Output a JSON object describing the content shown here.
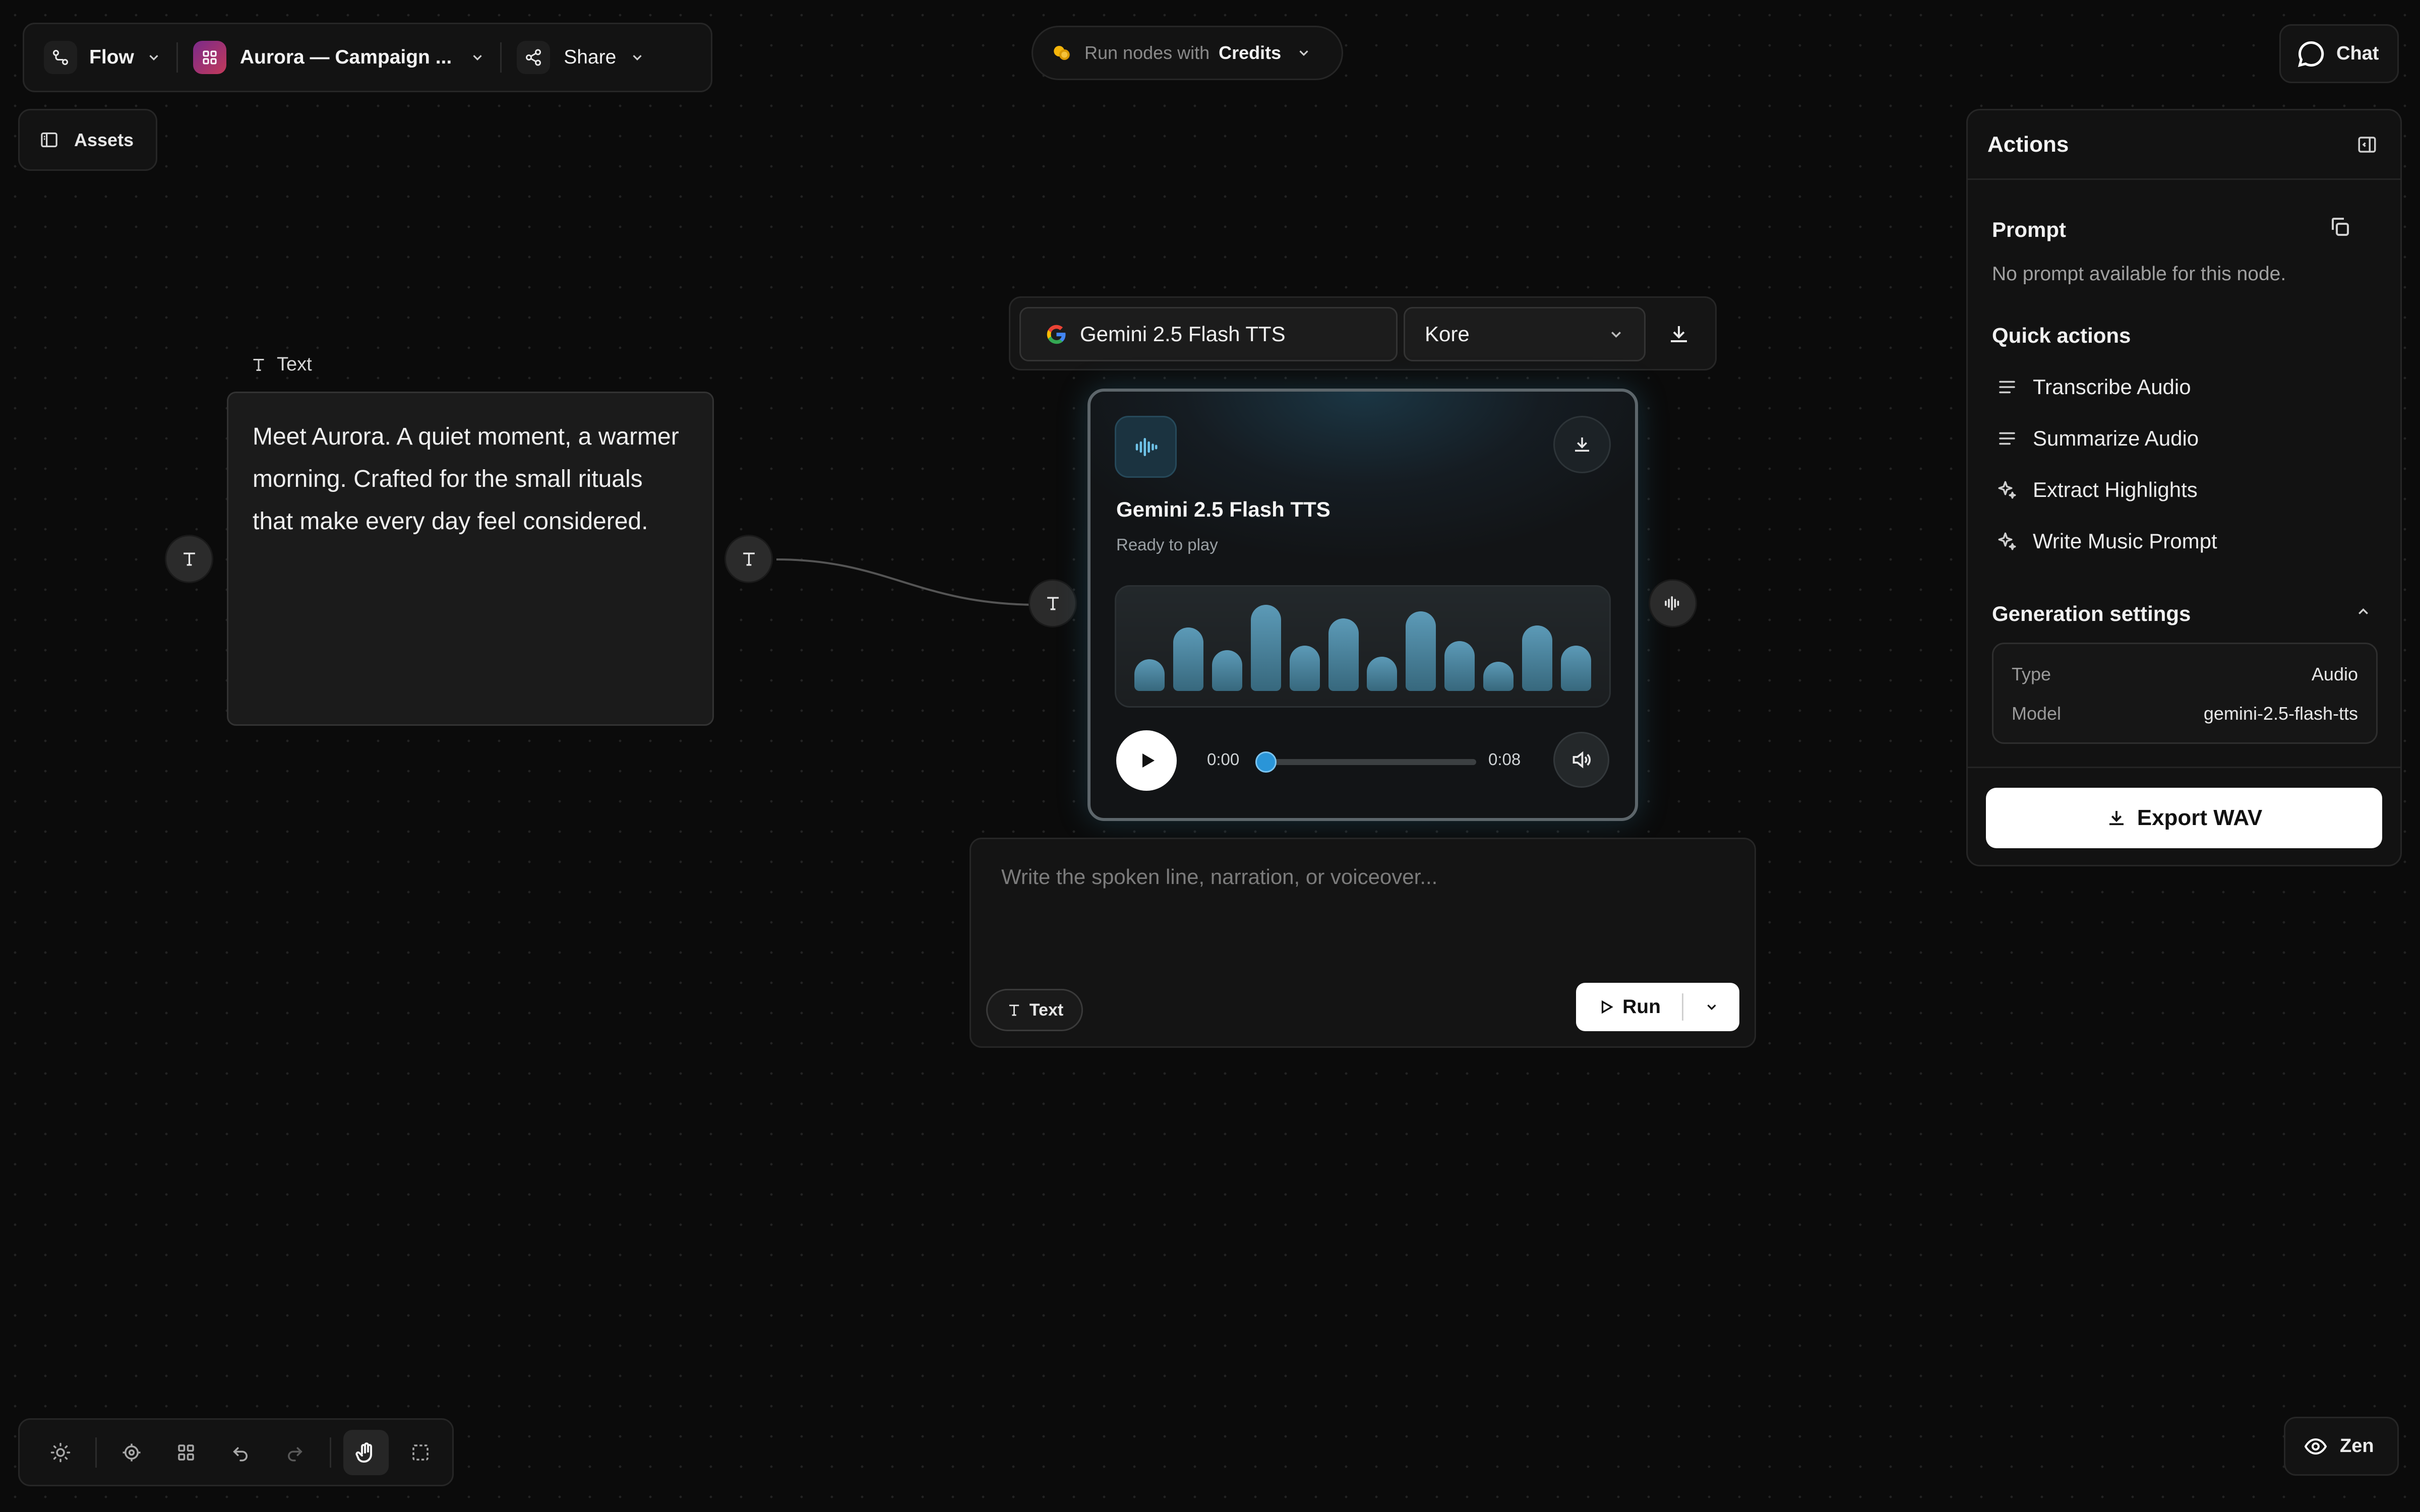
{
  "toolbar": {
    "mode_label": "Flow",
    "project_label": "Aurora — Campaign ...",
    "share_label": "Share"
  },
  "assets_label": "Assets",
  "credits": {
    "prefix": "Run nodes with",
    "value": "Credits"
  },
  "chat_label": "Chat",
  "text_node": {
    "type_label": "Text",
    "content": "Meet Aurora. A quiet moment, a warmer morning. Crafted for the small rituals that make every day feel considered."
  },
  "model_bar": {
    "model": "Gemini 2.5 Flash TTS",
    "voice": "Kore"
  },
  "audio_node": {
    "title": "Gemini 2.5 Flash TTS",
    "status": "Ready to play",
    "time_current": "0:00",
    "time_total": "0:08",
    "progress": 0.0,
    "waveform_levels": [
      0.35,
      0.7,
      0.45,
      0.95,
      0.5,
      0.8,
      0.38,
      0.88,
      0.55,
      0.32,
      0.72,
      0.5
    ]
  },
  "composer": {
    "placeholder": "Write the spoken line, narration, or voiceover...",
    "input_type": "Text",
    "run_label": "Run"
  },
  "actions_panel": {
    "title": "Actions",
    "prompt_title": "Prompt",
    "prompt_empty": "No prompt available for this node.",
    "quick_actions_title": "Quick actions",
    "quick_actions": [
      {
        "label": "Transcribe Audio",
        "icon": "lines-icon"
      },
      {
        "label": "Summarize Audio",
        "icon": "lines-icon"
      },
      {
        "label": "Extract Highlights",
        "icon": "sparkle-icon"
      },
      {
        "label": "Write Music Prompt",
        "icon": "sparkle-icon"
      }
    ],
    "generation_title": "Generation settings",
    "settings": [
      {
        "key": "Type",
        "value": "Audio"
      },
      {
        "key": "Model",
        "value": "gemini-2.5-flash-tts"
      }
    ],
    "export_label": "Export WAV"
  },
  "zen_label": "Zen",
  "colors": {
    "background": "#0b0b0b",
    "accent_blue": "#2a95d8",
    "credits_coin": "#f5b50a"
  }
}
